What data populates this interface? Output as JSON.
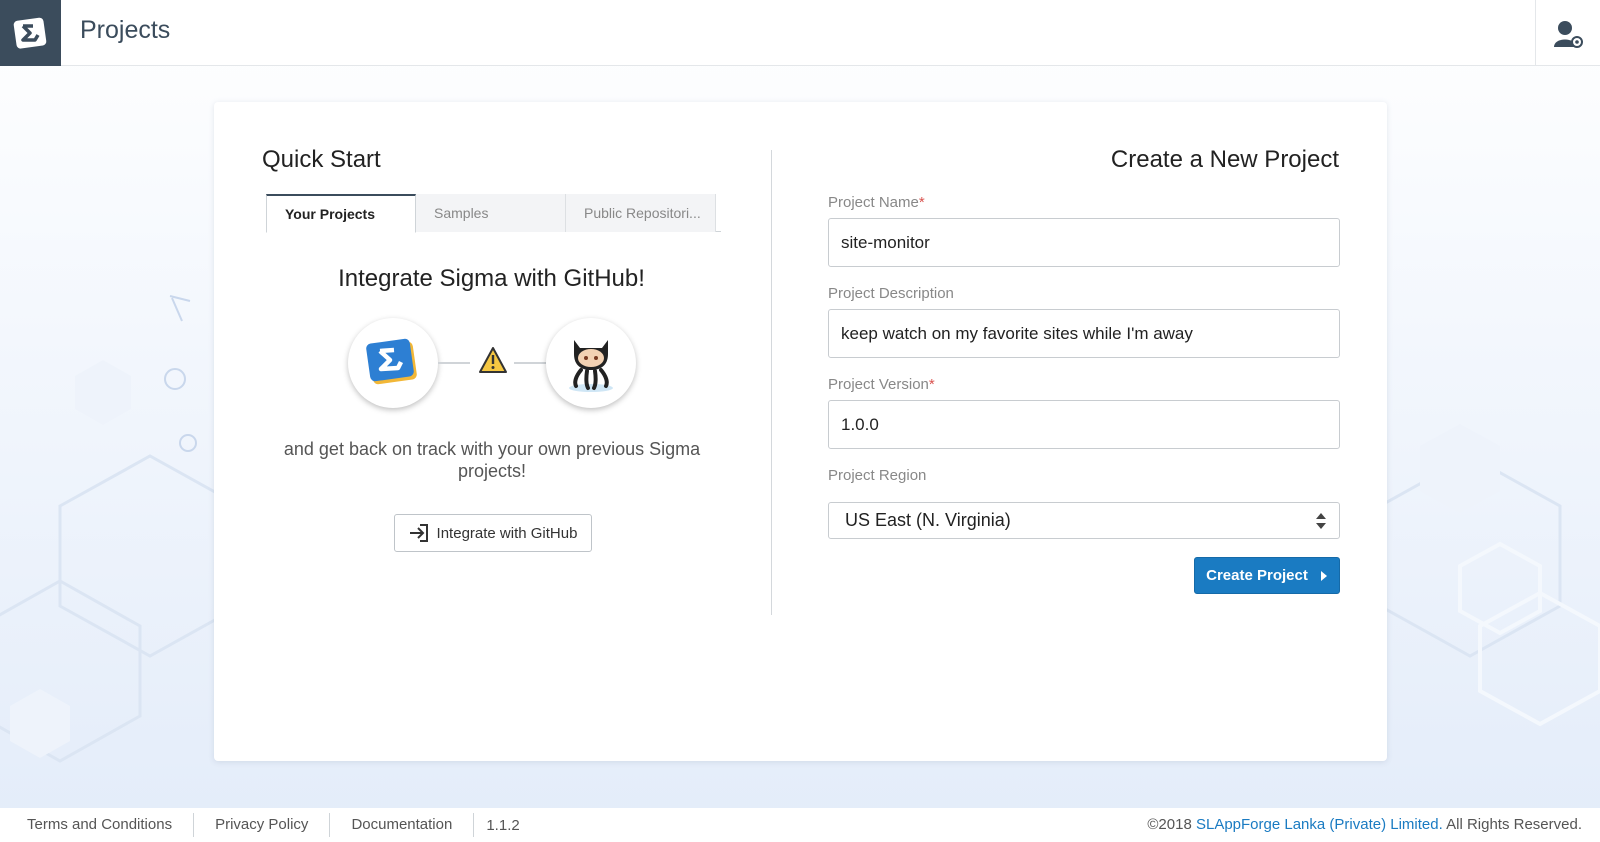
{
  "header": {
    "title": "Projects",
    "logo_icon": "sigma-logo-icon",
    "account_icon": "user-settings-icon"
  },
  "quick_start": {
    "title": "Quick Start",
    "tabs": [
      {
        "label": "Your Projects",
        "active": true
      },
      {
        "label": "Samples",
        "active": false
      },
      {
        "label": "Public Repositori...",
        "active": false
      }
    ],
    "github_title": "Integrate Sigma with GitHub!",
    "github_description": "and get back on track with your own previous Sigma projects!",
    "github_button_label": "Integrate with GitHub",
    "icons": [
      "sigma-logo-icon",
      "warning-icon",
      "github-octocat-icon"
    ]
  },
  "new_project": {
    "title": "Create a New Project",
    "fields": {
      "name": {
        "label": "Project Name",
        "required_mark": "*",
        "value": "site-monitor"
      },
      "description": {
        "label": "Project Description",
        "value": "keep watch on my favorite sites while I'm away"
      },
      "version": {
        "label": "Project Version",
        "required_mark": "*",
        "value": "1.0.0"
      },
      "region": {
        "label": "Project Region",
        "selected": "US East (N. Virginia)"
      }
    },
    "submit_label": "Create Project"
  },
  "footer": {
    "links": [
      "Terms and Conditions",
      "Privacy Policy",
      "Documentation"
    ],
    "version": "1.1.2",
    "copyright_prefix": "©2018",
    "company": "SLAppForge Lanka (Private) Limited.",
    "rights": "All Rights Reserved."
  },
  "colors": {
    "brand_dark": "#3b4c5c",
    "primary": "#1a7bc2",
    "required": "#d9534f"
  }
}
